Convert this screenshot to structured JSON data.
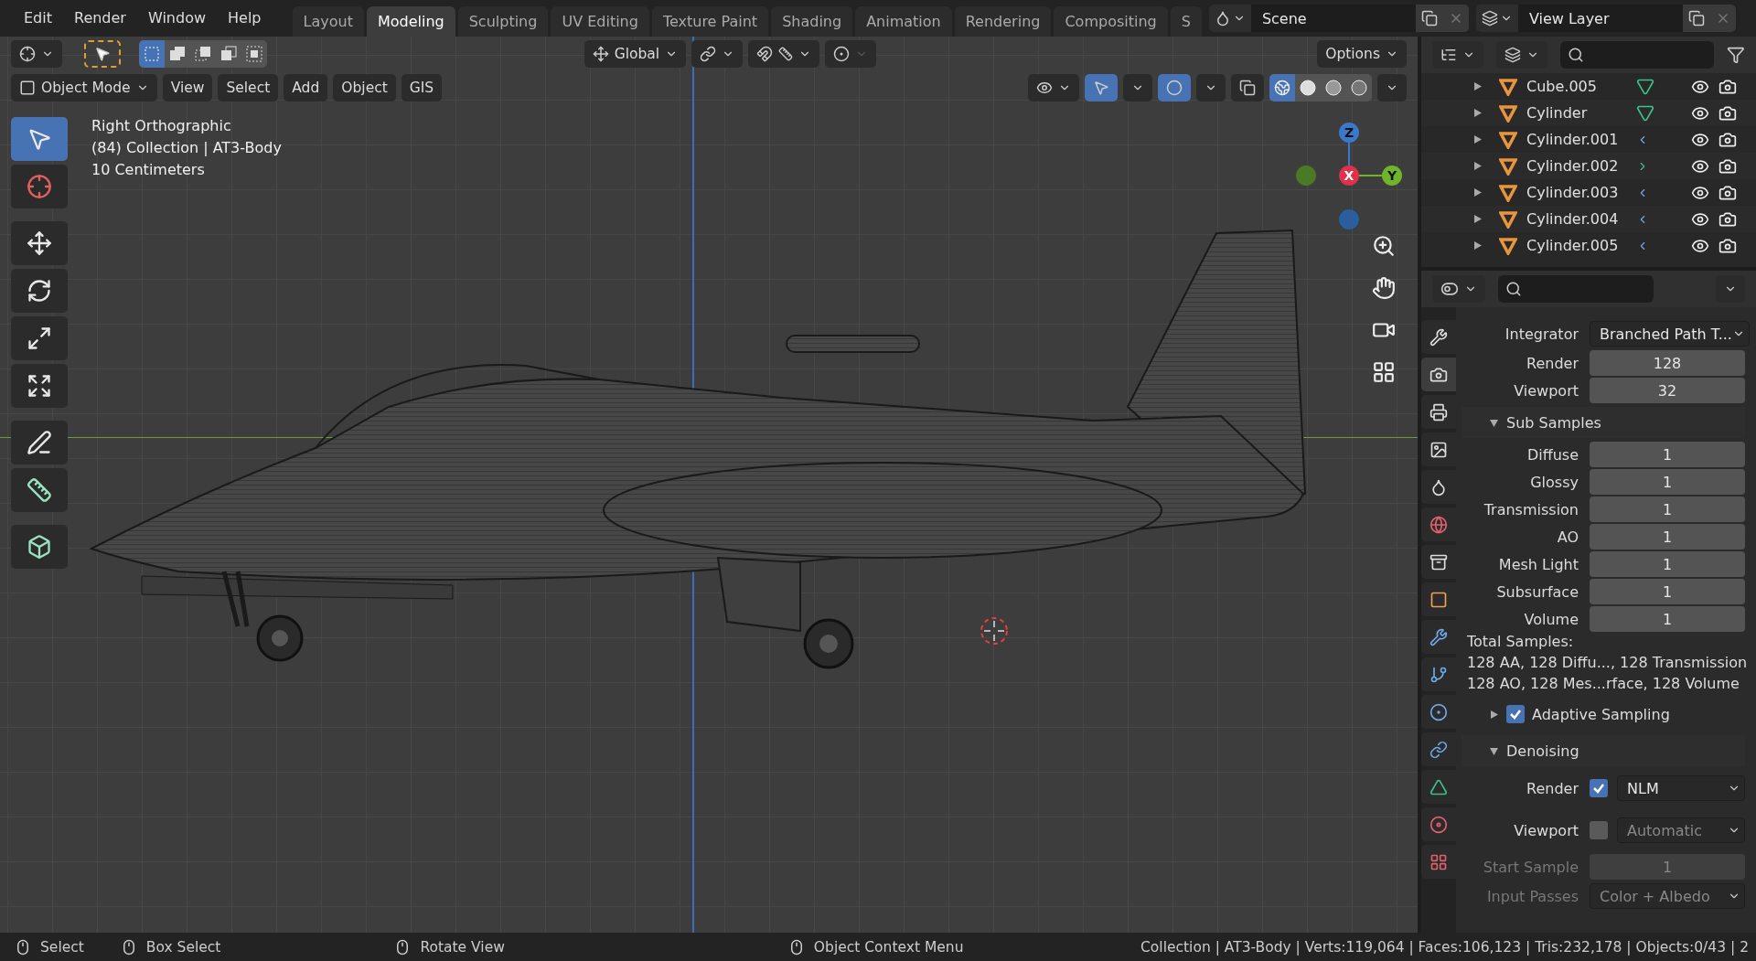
{
  "menu": [
    "Edit",
    "Render",
    "Window",
    "Help"
  ],
  "workspace_tabs": [
    {
      "label": "Layout",
      "selected": false
    },
    {
      "label": "Modeling",
      "selected": true
    },
    {
      "label": "Sculpting",
      "selected": false
    },
    {
      "label": "UV Editing",
      "selected": false
    },
    {
      "label": "Texture Paint",
      "selected": false
    },
    {
      "label": "Shading",
      "selected": false
    },
    {
      "label": "Animation",
      "selected": false
    },
    {
      "label": "Rendering",
      "selected": false
    },
    {
      "label": "Compositing",
      "selected": false
    },
    {
      "label": "S",
      "selected": false
    }
  ],
  "scene": {
    "value": "Scene"
  },
  "view_layer": {
    "value": "View Layer"
  },
  "tool_header": {
    "select_modes": [
      {
        "kind": "new",
        "selected": true
      },
      {
        "kind": "extend",
        "selected": false
      },
      {
        "kind": "subtract",
        "selected": false
      },
      {
        "kind": "invert",
        "selected": false
      },
      {
        "kind": "intersect",
        "selected": false
      }
    ],
    "orientation": "Global",
    "options": "Options"
  },
  "viewport_header": {
    "mode": "Object Mode",
    "menus": [
      "View",
      "Select",
      "Add",
      "Object",
      "GIS"
    ],
    "shading_modes": [
      {
        "kind": "wireframe",
        "selected": true
      },
      {
        "kind": "solid",
        "selected": false
      },
      {
        "kind": "material",
        "selected": false
      },
      {
        "kind": "rendered",
        "selected": false
      }
    ]
  },
  "viewport": {
    "overlay_text": [
      "Right Orthographic",
      "(84) Collection | AT3-Body",
      "10 Centimeters"
    ],
    "tools": [
      {
        "kind": "select-box",
        "selected": true
      },
      {
        "kind": "cursor",
        "selected": false
      },
      {
        "kind": "move",
        "selected": false
      },
      {
        "kind": "rotate",
        "selected": false
      },
      {
        "kind": "scale",
        "selected": false
      },
      {
        "kind": "transform",
        "selected": false
      },
      {
        "kind": "annotate",
        "selected": false
      },
      {
        "kind": "measure",
        "selected": false
      },
      {
        "kind": "add-cube",
        "selected": false
      }
    ],
    "gizmo": {
      "z": "Z",
      "x": "X",
      "y": "Y"
    }
  },
  "outliner": {
    "items": [
      {
        "name": "Cube.005",
        "kind": "mesh"
      },
      {
        "name": "Cylinder",
        "kind": "mesh"
      },
      {
        "name": "Cylinder.001",
        "kind": "modifier"
      },
      {
        "name": "Cylinder.002",
        "kind": "hook"
      },
      {
        "name": "Cylinder.003",
        "kind": "modifier"
      },
      {
        "name": "Cylinder.004",
        "kind": "modifier"
      },
      {
        "name": "Cylinder.005",
        "kind": "modifier"
      }
    ]
  },
  "properties": {
    "tabs": [
      {
        "kind": "tool",
        "selected": false
      },
      {
        "kind": "render",
        "selected": true
      },
      {
        "kind": "output",
        "selected": false
      },
      {
        "kind": "view-layer",
        "selected": false
      },
      {
        "kind": "scene",
        "selected": false
      },
      {
        "kind": "world",
        "selected": false
      },
      {
        "kind": "collection",
        "selected": false
      },
      {
        "kind": "object",
        "selected": false
      },
      {
        "kind": "modifiers",
        "selected": false
      },
      {
        "kind": "particles",
        "selected": false
      },
      {
        "kind": "physics",
        "selected": false
      },
      {
        "kind": "constraints",
        "selected": false
      },
      {
        "kind": "data",
        "selected": false
      },
      {
        "kind": "material",
        "selected": false
      },
      {
        "kind": "texture",
        "selected": false
      }
    ],
    "rows": [
      {
        "kind": "dropdown",
        "label": "Integrator",
        "value": "Branched Path T...",
        "disabled": false
      },
      {
        "kind": "number",
        "label": "Render",
        "value": "128",
        "disabled": false
      },
      {
        "kind": "number",
        "label": "Viewport",
        "value": "32",
        "disabled": false
      },
      {
        "kind": "subpanel",
        "label": "Sub Samples",
        "expanded": true
      },
      {
        "kind": "number",
        "label": "Diffuse",
        "value": "1",
        "disabled": false
      },
      {
        "kind": "number",
        "label": "Glossy",
        "value": "1",
        "disabled": false
      },
      {
        "kind": "number",
        "label": "Transmission",
        "value": "1",
        "disabled": false
      },
      {
        "kind": "number",
        "label": "AO",
        "value": "1",
        "disabled": false
      },
      {
        "kind": "number",
        "label": "Mesh Light",
        "value": "1",
        "disabled": false
      },
      {
        "kind": "number",
        "label": "Subsurface",
        "value": "1",
        "disabled": false
      },
      {
        "kind": "number",
        "label": "Volume",
        "value": "1",
        "disabled": false
      },
      {
        "kind": "text",
        "label": "Total Samples:"
      },
      {
        "kind": "text",
        "label": "128 AA, 128 Diffu..., 128 Transmission"
      },
      {
        "kind": "text",
        "label": "128 AO, 128 Mes...rface, 128 Volume"
      },
      {
        "kind": "subpanel-check",
        "label": "Adaptive Sampling",
        "expanded": false,
        "checked": true
      },
      {
        "kind": "subpanel",
        "label": "Denoising",
        "expanded": true
      },
      {
        "kind": "check-dropdown",
        "label": "Render",
        "value": "NLM",
        "checked": true,
        "disabled": false
      },
      {
        "kind": "check-dropdown",
        "label": "Viewport",
        "value": "Automatic",
        "checked": false,
        "disabled": true
      },
      {
        "kind": "number",
        "label": "Start Sample",
        "value": "1",
        "disabled": true
      },
      {
        "kind": "dropdown",
        "label": "Input Passes",
        "value": "Color + Albedo",
        "disabled": true
      }
    ]
  },
  "status_bar": {
    "hints": [
      "Select",
      "Box Select",
      "Rotate View",
      "Object Context Menu"
    ],
    "stats": "Collection | AT3-Body | Verts:119,064 | Faces:106,123 | Tris:232,178 | Objects:0/43 | 2"
  }
}
